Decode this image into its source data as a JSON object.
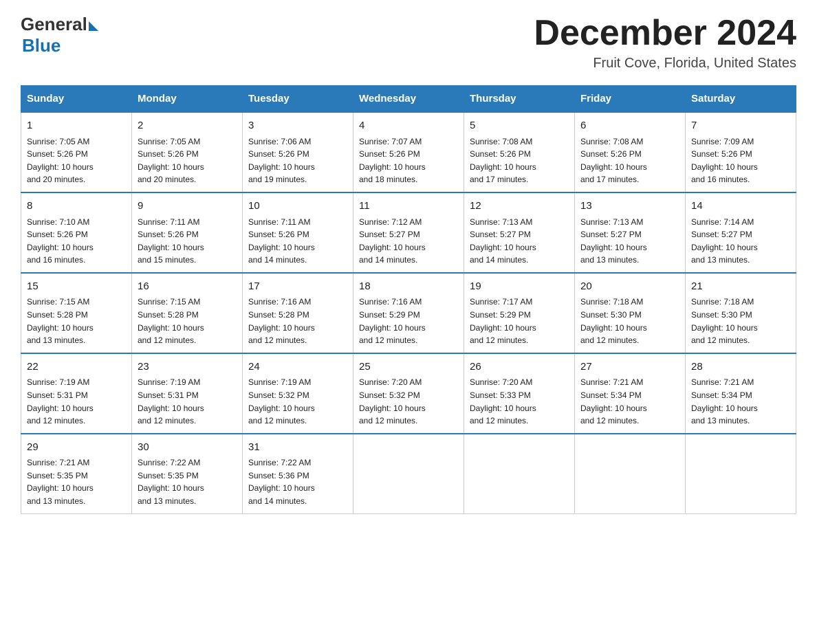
{
  "header": {
    "logo_general": "General",
    "logo_blue": "Blue",
    "month_year": "December 2024",
    "location": "Fruit Cove, Florida, United States"
  },
  "weekdays": [
    "Sunday",
    "Monday",
    "Tuesday",
    "Wednesday",
    "Thursday",
    "Friday",
    "Saturday"
  ],
  "weeks": [
    [
      {
        "day": "1",
        "sunrise": "7:05 AM",
        "sunset": "5:26 PM",
        "daylight": "10 hours and 20 minutes."
      },
      {
        "day": "2",
        "sunrise": "7:05 AM",
        "sunset": "5:26 PM",
        "daylight": "10 hours and 20 minutes."
      },
      {
        "day": "3",
        "sunrise": "7:06 AM",
        "sunset": "5:26 PM",
        "daylight": "10 hours and 19 minutes."
      },
      {
        "day": "4",
        "sunrise": "7:07 AM",
        "sunset": "5:26 PM",
        "daylight": "10 hours and 18 minutes."
      },
      {
        "day": "5",
        "sunrise": "7:08 AM",
        "sunset": "5:26 PM",
        "daylight": "10 hours and 17 minutes."
      },
      {
        "day": "6",
        "sunrise": "7:08 AM",
        "sunset": "5:26 PM",
        "daylight": "10 hours and 17 minutes."
      },
      {
        "day": "7",
        "sunrise": "7:09 AM",
        "sunset": "5:26 PM",
        "daylight": "10 hours and 16 minutes."
      }
    ],
    [
      {
        "day": "8",
        "sunrise": "7:10 AM",
        "sunset": "5:26 PM",
        "daylight": "10 hours and 16 minutes."
      },
      {
        "day": "9",
        "sunrise": "7:11 AM",
        "sunset": "5:26 PM",
        "daylight": "10 hours and 15 minutes."
      },
      {
        "day": "10",
        "sunrise": "7:11 AM",
        "sunset": "5:26 PM",
        "daylight": "10 hours and 14 minutes."
      },
      {
        "day": "11",
        "sunrise": "7:12 AM",
        "sunset": "5:27 PM",
        "daylight": "10 hours and 14 minutes."
      },
      {
        "day": "12",
        "sunrise": "7:13 AM",
        "sunset": "5:27 PM",
        "daylight": "10 hours and 14 minutes."
      },
      {
        "day": "13",
        "sunrise": "7:13 AM",
        "sunset": "5:27 PM",
        "daylight": "10 hours and 13 minutes."
      },
      {
        "day": "14",
        "sunrise": "7:14 AM",
        "sunset": "5:27 PM",
        "daylight": "10 hours and 13 minutes."
      }
    ],
    [
      {
        "day": "15",
        "sunrise": "7:15 AM",
        "sunset": "5:28 PM",
        "daylight": "10 hours and 13 minutes."
      },
      {
        "day": "16",
        "sunrise": "7:15 AM",
        "sunset": "5:28 PM",
        "daylight": "10 hours and 12 minutes."
      },
      {
        "day": "17",
        "sunrise": "7:16 AM",
        "sunset": "5:28 PM",
        "daylight": "10 hours and 12 minutes."
      },
      {
        "day": "18",
        "sunrise": "7:16 AM",
        "sunset": "5:29 PM",
        "daylight": "10 hours and 12 minutes."
      },
      {
        "day": "19",
        "sunrise": "7:17 AM",
        "sunset": "5:29 PM",
        "daylight": "10 hours and 12 minutes."
      },
      {
        "day": "20",
        "sunrise": "7:18 AM",
        "sunset": "5:30 PM",
        "daylight": "10 hours and 12 minutes."
      },
      {
        "day": "21",
        "sunrise": "7:18 AM",
        "sunset": "5:30 PM",
        "daylight": "10 hours and 12 minutes."
      }
    ],
    [
      {
        "day": "22",
        "sunrise": "7:19 AM",
        "sunset": "5:31 PM",
        "daylight": "10 hours and 12 minutes."
      },
      {
        "day": "23",
        "sunrise": "7:19 AM",
        "sunset": "5:31 PM",
        "daylight": "10 hours and 12 minutes."
      },
      {
        "day": "24",
        "sunrise": "7:19 AM",
        "sunset": "5:32 PM",
        "daylight": "10 hours and 12 minutes."
      },
      {
        "day": "25",
        "sunrise": "7:20 AM",
        "sunset": "5:32 PM",
        "daylight": "10 hours and 12 minutes."
      },
      {
        "day": "26",
        "sunrise": "7:20 AM",
        "sunset": "5:33 PM",
        "daylight": "10 hours and 12 minutes."
      },
      {
        "day": "27",
        "sunrise": "7:21 AM",
        "sunset": "5:34 PM",
        "daylight": "10 hours and 12 minutes."
      },
      {
        "day": "28",
        "sunrise": "7:21 AM",
        "sunset": "5:34 PM",
        "daylight": "10 hours and 13 minutes."
      }
    ],
    [
      {
        "day": "29",
        "sunrise": "7:21 AM",
        "sunset": "5:35 PM",
        "daylight": "10 hours and 13 minutes."
      },
      {
        "day": "30",
        "sunrise": "7:22 AM",
        "sunset": "5:35 PM",
        "daylight": "10 hours and 13 minutes."
      },
      {
        "day": "31",
        "sunrise": "7:22 AM",
        "sunset": "5:36 PM",
        "daylight": "10 hours and 14 minutes."
      },
      null,
      null,
      null,
      null
    ]
  ],
  "labels": {
    "sunrise": "Sunrise:",
    "sunset": "Sunset:",
    "daylight": "Daylight:"
  }
}
